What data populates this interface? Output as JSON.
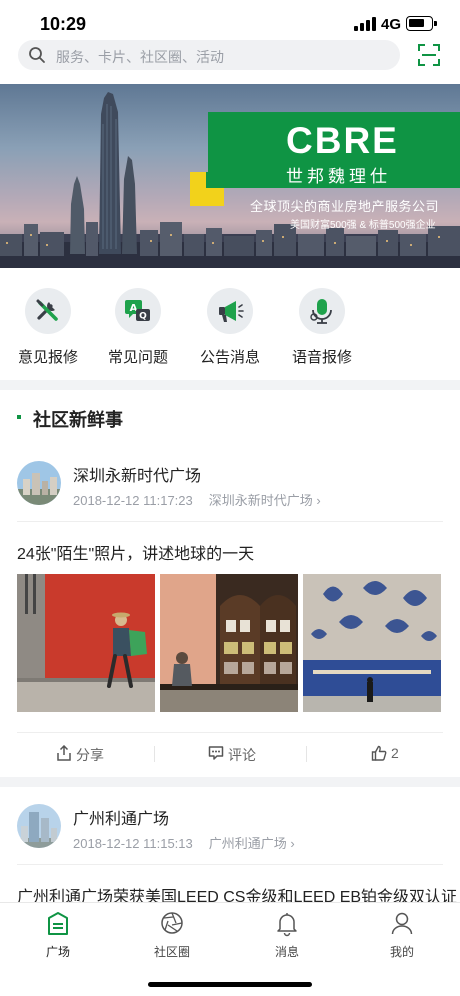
{
  "status": {
    "time": "10:29",
    "network": "4G"
  },
  "search": {
    "placeholder": "服务、卡片、社区圈、活动"
  },
  "banner": {
    "logo": "CBRE",
    "logo_cn": "世邦魏理仕",
    "tagline": "全球顶尖的商业房地产服务公司",
    "subtagline": "美国财富500强 & 标普500强企业",
    "brand_green": "#0f9444",
    "brand_yellow": "#f2d21b"
  },
  "quick_actions": [
    {
      "label": "意见报修",
      "icon": "tools-icon"
    },
    {
      "label": "常见问题",
      "icon": "qa-icon"
    },
    {
      "label": "公告消息",
      "icon": "megaphone-icon"
    },
    {
      "label": "语音报修",
      "icon": "microphone-icon"
    }
  ],
  "section": {
    "title": "社区新鲜事"
  },
  "posts": [
    {
      "name": "深圳永新时代广场",
      "time": "2018-12-12 11:17:23",
      "place": "深圳永新时代广场 ›",
      "text": "24张\"陌生\"照片，讲述地球的一天",
      "share_label": "分享",
      "comment_label": "评论",
      "like_count": "2"
    },
    {
      "name": "广州利通广场",
      "time": "2018-12-12 11:15:13",
      "place": "广州利通广场 ›",
      "text": "广州利通广场荣获美国LEED CS金级和LEED EB铂金级双认证"
    }
  ],
  "tabs": [
    {
      "label": "广场",
      "icon": "square-home-icon",
      "active": true
    },
    {
      "label": "社区圈",
      "icon": "aperture-icon"
    },
    {
      "label": "消息",
      "icon": "bell-icon"
    },
    {
      "label": "我的",
      "icon": "person-icon"
    }
  ],
  "colors": {
    "accent": "#0f9444",
    "muted_text": "#9a9ea6"
  }
}
